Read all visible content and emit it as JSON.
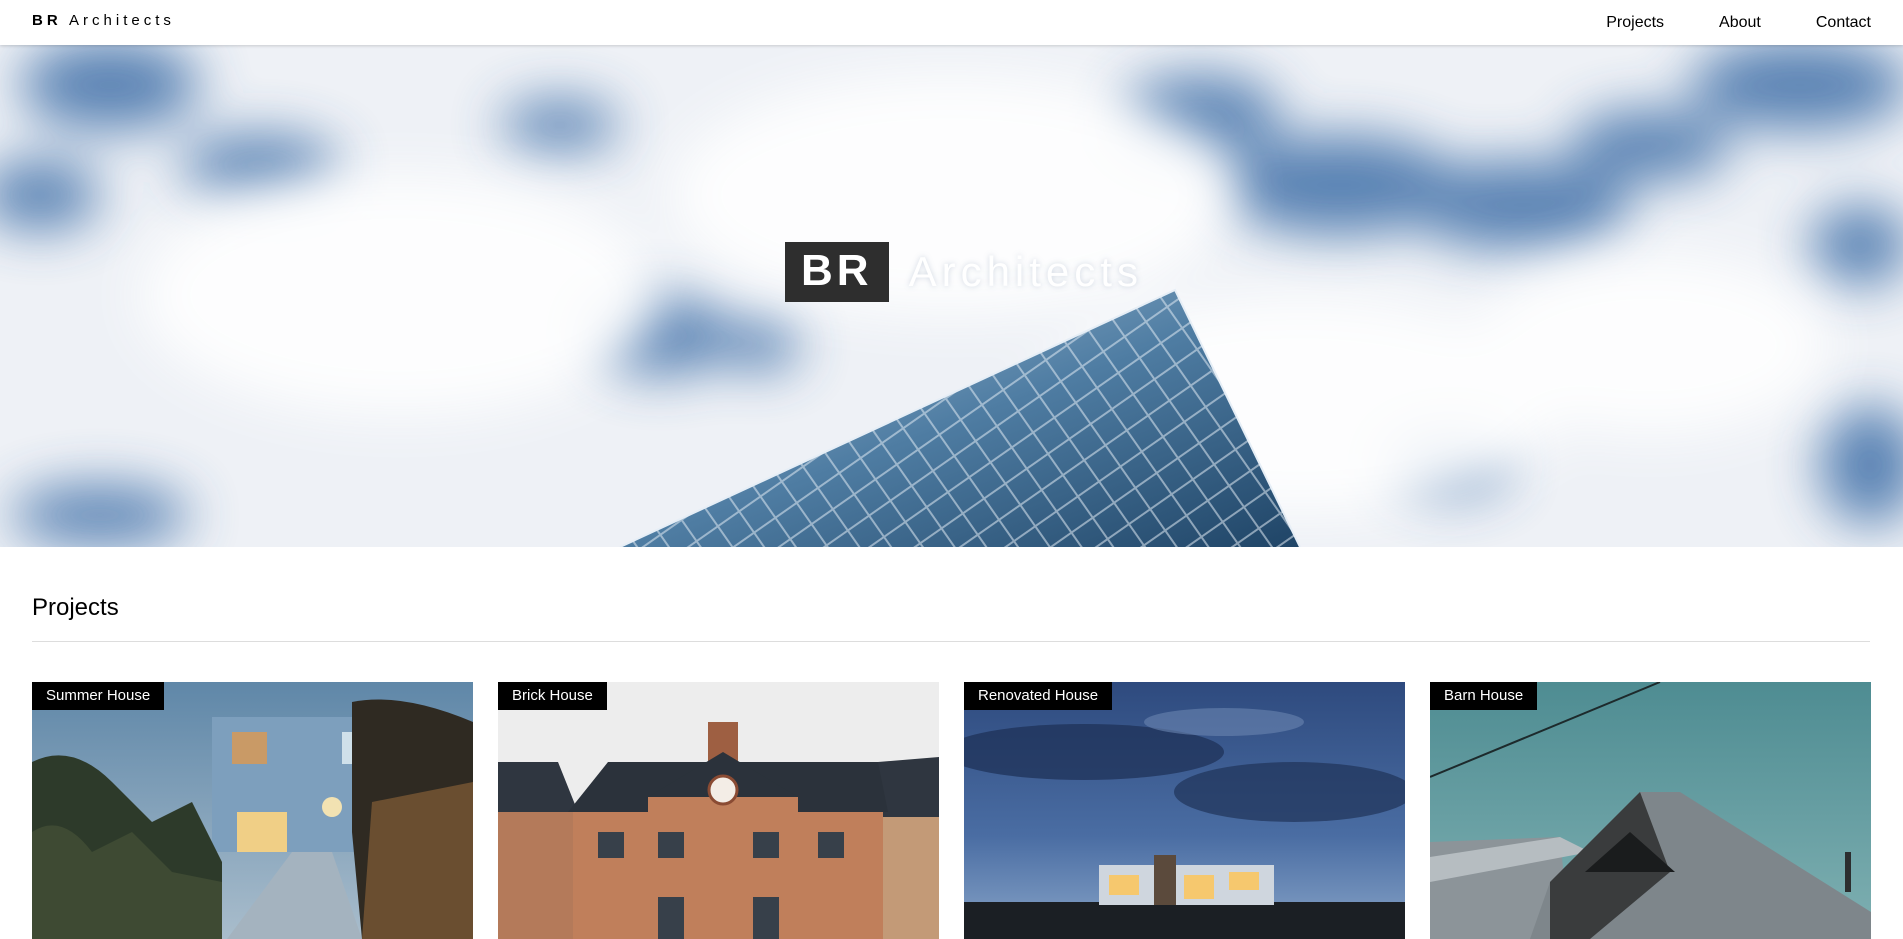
{
  "header": {
    "brand_bold": "BR",
    "brand_rest": "Architects",
    "nav": [
      {
        "label": "Projects"
      },
      {
        "label": "About"
      },
      {
        "label": "Contact"
      }
    ]
  },
  "hero": {
    "title_box": "BR",
    "title_text": "Architects"
  },
  "projects": {
    "heading": "Projects",
    "items": [
      {
        "title": "Summer House"
      },
      {
        "title": "Brick House"
      },
      {
        "title": "Renovated House"
      },
      {
        "title": "Barn House"
      }
    ]
  },
  "colors": {
    "label_bg": "#000000",
    "hero_box_bg": "#2e2e2e",
    "sky_blue": "#3f6fa8"
  }
}
